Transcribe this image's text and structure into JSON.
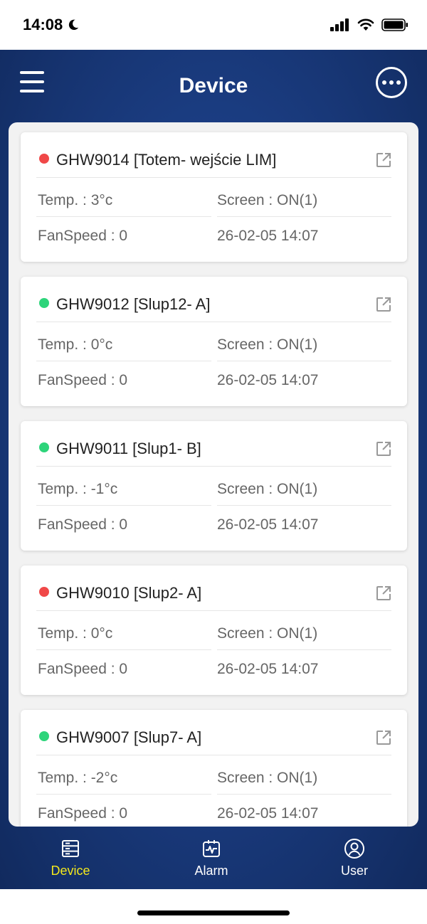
{
  "status_bar": {
    "time": "14:08",
    "icons": [
      "moon-icon",
      "signal-icon",
      "wifi-icon",
      "battery-icon"
    ]
  },
  "header": {
    "title": "Device",
    "menu_icon": "hamburger-menu-icon",
    "more_icon": "more-options-icon"
  },
  "devices": [
    {
      "name": "GHW9014 [Totem- wejście LIM]",
      "status": "offline",
      "status_color": "#f04848",
      "temp": "Temp. : 3°c",
      "screen": "Screen : ON(1)",
      "fan": "FanSpeed : 0",
      "updated": "26-02-05 14:07"
    },
    {
      "name": "GHW9012 [Slup12- A]",
      "status": "online",
      "status_color": "#2dd47a",
      "temp": "Temp. : 0°c",
      "screen": "Screen : ON(1)",
      "fan": "FanSpeed : 0",
      "updated": "26-02-05 14:07"
    },
    {
      "name": "GHW9011 [Slup1- B]",
      "status": "online",
      "status_color": "#2dd47a",
      "temp": "Temp. : -1°c",
      "screen": "Screen : ON(1)",
      "fan": "FanSpeed : 0",
      "updated": "26-02-05 14:07"
    },
    {
      "name": "GHW9010 [Slup2- A]",
      "status": "offline",
      "status_color": "#f04848",
      "temp": "Temp. : 0°c",
      "screen": "Screen : ON(1)",
      "fan": "FanSpeed : 0",
      "updated": "26-02-05 14:07"
    },
    {
      "name": "GHW9007 [Slup7- A]",
      "status": "online",
      "status_color": "#2dd47a",
      "temp": "Temp. : -2°c",
      "screen": "Screen : ON(1)",
      "fan": "FanSpeed : 0",
      "updated": "26-02-05 14:07"
    }
  ],
  "tabbar": {
    "tabs": [
      {
        "label": "Device",
        "icon": "server-icon",
        "active": true
      },
      {
        "label": "Alarm",
        "icon": "alarm-monitor-icon",
        "active": false
      },
      {
        "label": "User",
        "icon": "user-icon",
        "active": false
      }
    ],
    "active_color": "#f3e81c"
  }
}
